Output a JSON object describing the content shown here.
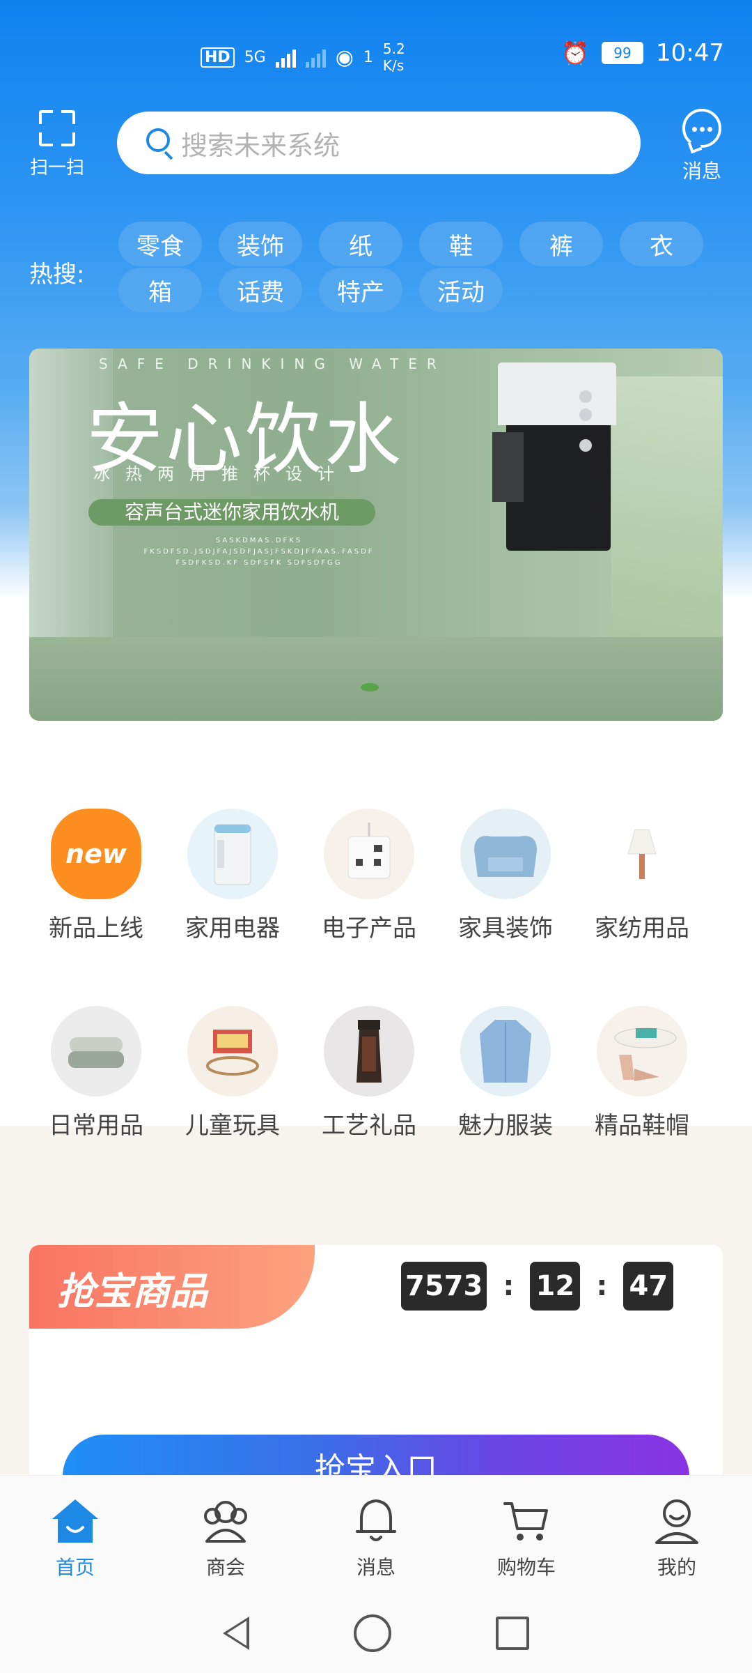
{
  "status_bar": {
    "hd_label": "HD",
    "network": "5G",
    "sim_num": "1",
    "speed_value": "5.2",
    "speed_unit": "K/s",
    "battery": "99",
    "time": "10:47"
  },
  "header": {
    "scan_label": "扫一扫",
    "search_placeholder": "搜索未来系统",
    "message_label": "消息"
  },
  "hot_search": {
    "label": "热搜:",
    "tags": [
      "零食",
      "装饰",
      "纸",
      "鞋",
      "裤",
      "衣",
      "箱",
      "话费",
      "特产",
      "活动"
    ]
  },
  "banner": {
    "english": "SAFE DRINKING WATER",
    "title": "安心饮水",
    "subtitle": "冰热两用推杯设计",
    "product": "容声台式迷你家用饮水机",
    "fine_print": "SASKDMAS.DFKS FKSDFSD.JSDJFAJSDFJASJFSKDJFFAAS.FASDF FSDFKSD.KF SDFSFK SDFSDFGG"
  },
  "categories_row1": [
    {
      "label": "新品上线",
      "icon": "new-icon",
      "badge": "new"
    },
    {
      "label": "家用电器",
      "icon": "appliance-icon"
    },
    {
      "label": "电子产品",
      "icon": "power-strip-icon"
    },
    {
      "label": "家具装饰",
      "icon": "sofa-icon"
    },
    {
      "label": "家纺用品",
      "icon": "lamp-icon"
    }
  ],
  "categories_row2": [
    {
      "label": "日常用品",
      "icon": "towel-icon"
    },
    {
      "label": "儿童玩具",
      "icon": "toy-train-icon"
    },
    {
      "label": "工艺礼品",
      "icon": "vase-icon"
    },
    {
      "label": "魅力服装",
      "icon": "shirt-icon"
    },
    {
      "label": "精品鞋帽",
      "icon": "shoes-hat-icon"
    }
  ],
  "flash_sale": {
    "title": "抢宝商品",
    "hours": "7573",
    "minutes": "12",
    "seconds": "47",
    "separator": ":",
    "button_label": "抢宝入口"
  },
  "tabbar": [
    {
      "label": "首页",
      "icon": "home-icon",
      "active": true
    },
    {
      "label": "商会",
      "icon": "group-icon"
    },
    {
      "label": "消息",
      "icon": "bell-icon"
    },
    {
      "label": "购物车",
      "icon": "cart-icon"
    },
    {
      "label": "我的",
      "icon": "user-icon"
    }
  ],
  "colors": {
    "primary": "#1e88e5",
    "header_blue": "#0f82f0",
    "sale_orange": "#f87462",
    "new_orange": "#fc8f1f"
  }
}
